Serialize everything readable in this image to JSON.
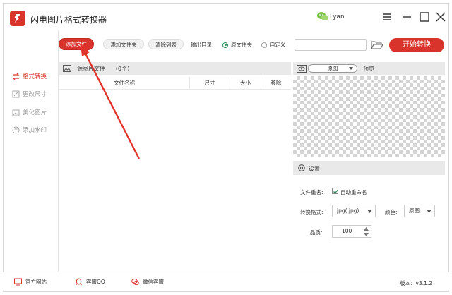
{
  "app": {
    "title": "闪电图片格式转换器",
    "user": "Lyan",
    "version_label": "版本：v3.1.2"
  },
  "colors": {
    "accent": "#d9342b",
    "radio_checked": "#2e8b57",
    "panel_header": "#e9e9e9"
  },
  "sidebar": {
    "items": [
      {
        "label": "格式转换",
        "icon": "convert-icon",
        "active": true
      },
      {
        "label": "更改尺寸",
        "icon": "resize-icon",
        "active": false
      },
      {
        "label": "美化图片",
        "icon": "beautify-icon",
        "active": false
      },
      {
        "label": "添加水印",
        "icon": "watermark-icon",
        "active": false
      }
    ]
  },
  "toolbar": {
    "add_file": "添加文件",
    "add_folder": "添加文件夹",
    "clear_list": "清除列表",
    "output_dir_label": "输出目录:",
    "radio_original": "原文件夹",
    "radio_custom": "自定义",
    "path_value": "",
    "start": "开始转换"
  },
  "file_list": {
    "title": "源图片文件",
    "count": "（0个）",
    "columns": [
      "文件名称",
      "尺寸",
      "大小",
      "移除"
    ],
    "rows": []
  },
  "preview": {
    "mode": "原图",
    "label": "预览"
  },
  "settings": {
    "title": "设置",
    "rename_label": "文件重名:",
    "auto_rename": "自动重命名",
    "auto_rename_checked": true,
    "format_label": "转换格式:",
    "format_value": "jpg(.jpg)",
    "color_label": "颜色:",
    "color_value": "原图",
    "quality_label": "品质:",
    "quality_value": "100"
  },
  "footer": {
    "website": "官方网站",
    "qq": "客服QQ",
    "wechat": "微信客服"
  }
}
